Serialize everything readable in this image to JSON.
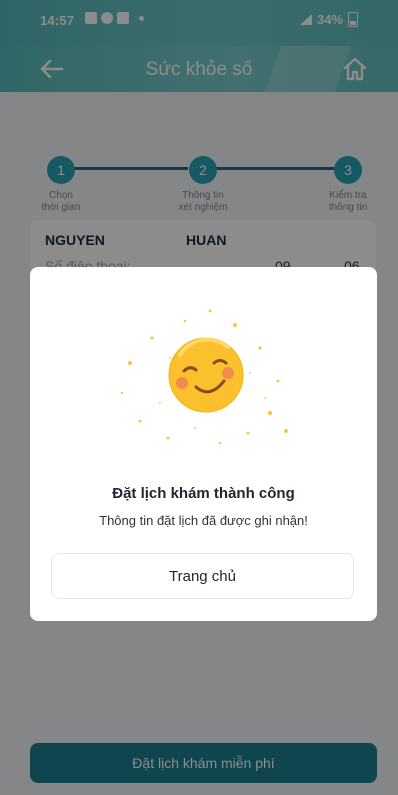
{
  "status_bar": {
    "time": "14:57",
    "battery": "34%"
  },
  "header": {
    "title": "Sức khỏe số"
  },
  "stepper": {
    "steps": [
      {
        "number": "1",
        "label_line1": "Chọn",
        "label_line2": "thời gian"
      },
      {
        "number": "2",
        "label_line1": "Thông tin",
        "label_line2": "xét nghiệm"
      },
      {
        "number": "3",
        "label_line1": "Kiểm tra",
        "label_line2": "thông tin"
      }
    ]
  },
  "info": {
    "last_name": "NGUYEN",
    "first_name": "HUAN",
    "phone_label": "Số điện thoại:",
    "phone_part1": "09",
    "phone_part2": "06"
  },
  "cta": {
    "label": "Đặt lịch khám miễn phí"
  },
  "modal": {
    "title": "Đặt lịch khám thành công",
    "message": "Thông tin đặt lịch đã được ghi nhận!",
    "button_label": "Trang chủ"
  },
  "colors": {
    "header": "#5fbdbe",
    "step": "#27a5b4",
    "step_line": "#1d6d8f",
    "cta": "#1b7f90",
    "smiley": "#fbc02d"
  },
  "icons": [
    "back-arrow-icon",
    "home-icon",
    "smiley-icon"
  ]
}
